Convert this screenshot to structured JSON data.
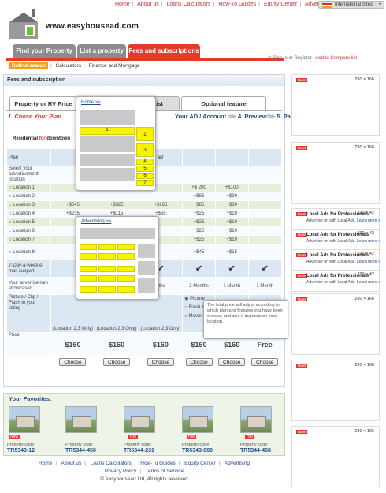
{
  "topnav": {
    "items": [
      "Home",
      "About us",
      "Loans Calculators",
      "How-To Guides",
      "Equity Center",
      "Advertising"
    ],
    "intl": "International Sites"
  },
  "logo": {
    "text": "www.easyhousead.com"
  },
  "tabs": [
    "Find your Property",
    "List a property",
    "Fees and subscriptions"
  ],
  "subnav": [
    "Refind search",
    "Calculators",
    "Finance and Mortgage"
  ],
  "signin": {
    "sign_in": "Sign In",
    "or": "or",
    "register": "Register",
    "compare": "Add to Compare list"
  },
  "panel": {
    "title": "Fees and subscription"
  },
  "ttabs": [
    "Property or RV Price",
    "ist",
    "Optional feature"
  ],
  "steps": {
    "active": "1. Chose Your Plan",
    "rest": "Your AD / Account",
    "preview": "4. Preview",
    "pay": "5. Paypal"
  },
  "resid": {
    "a": "Residential",
    "b": "for",
    "c": "downtown"
  },
  "grid": {
    "plan": "Plan",
    "select_lbl": "Select your advertisement location",
    "col_head": "lar",
    "locations": [
      "Location 1",
      "Location 2",
      "Location 3",
      "Location 4",
      "Location 5",
      "Location 6",
      "Location 7",
      "Location 8"
    ],
    "loc_vals": [
      [
        "+$ 280",
        "+$100"
      ],
      [
        "+$85",
        "+$30"
      ],
      [
        "+$85",
        "+$30"
      ],
      [
        "+$25",
        "+$10"
      ],
      [
        "+$25",
        "+$10"
      ],
      [
        "+$25",
        "+$10"
      ],
      [
        "+$25",
        "+$10"
      ],
      [
        "+$45",
        "+$15"
      ]
    ],
    "loc3_extra": [
      "+$645",
      "+$325",
      "+$165"
    ],
    "loc4_extra": [
      "+$235",
      "+$115",
      "+$55"
    ],
    "email_lbl": "7-Day-a-week e-mail support",
    "showcased_lbl": "Your advertisemen showcased",
    "showcased": [
      "nths",
      "3 Months",
      "1 Month",
      "1 Month"
    ],
    "picture_lbl": "Picture / Clip / Flash in your listing",
    "pic_opts": [
      "Picture",
      "Flash +$2",
      "Movie +$4"
    ],
    "location_note": [
      "(Location 2,3 Only)",
      "(Location 2,3 Only)",
      "(Location 2,3 Only)"
    ],
    "price_lbl": "Price",
    "prices": [
      "$160",
      "$160",
      "$160",
      "$160",
      "$160",
      "Free"
    ],
    "choose": "Choose"
  },
  "popup1": {
    "link": "Home >>",
    "cells": [
      "1",
      "2",
      "3",
      "4",
      "5",
      "6",
      "7"
    ]
  },
  "popup2": {
    "link": "Advertising >>"
  },
  "tooltip": "The total price will adjust according to which plan and features you have been choose, and also it depends on your location.",
  "favorites": {
    "title": "Your Favorites:",
    "code_label": "Property code:",
    "hot": "Hot",
    "new": "New",
    "codes": [
      "TR5343-12",
      "TR5344-458",
      "TR5344-231",
      "TR5343-889",
      "TR5344-458"
    ]
  },
  "footer": {
    "links": [
      "Home",
      "About us",
      "Loans Calculators",
      "How-To Guides",
      "Equity Center",
      "Advertising"
    ],
    "links2": [
      "Privacy Policy",
      "Terms of Service"
    ],
    "copy": "© easyhousead Ltd, All rights reserved"
  },
  "ads": {
    "big": "230 × 166",
    "small": "230 × 42",
    "small_title": "Local Ads for Professionals",
    "small_desc": "Advertise on",
    "small_desc2": "with Local Ads.",
    "learn": "Learn more »",
    "new": "New!"
  }
}
